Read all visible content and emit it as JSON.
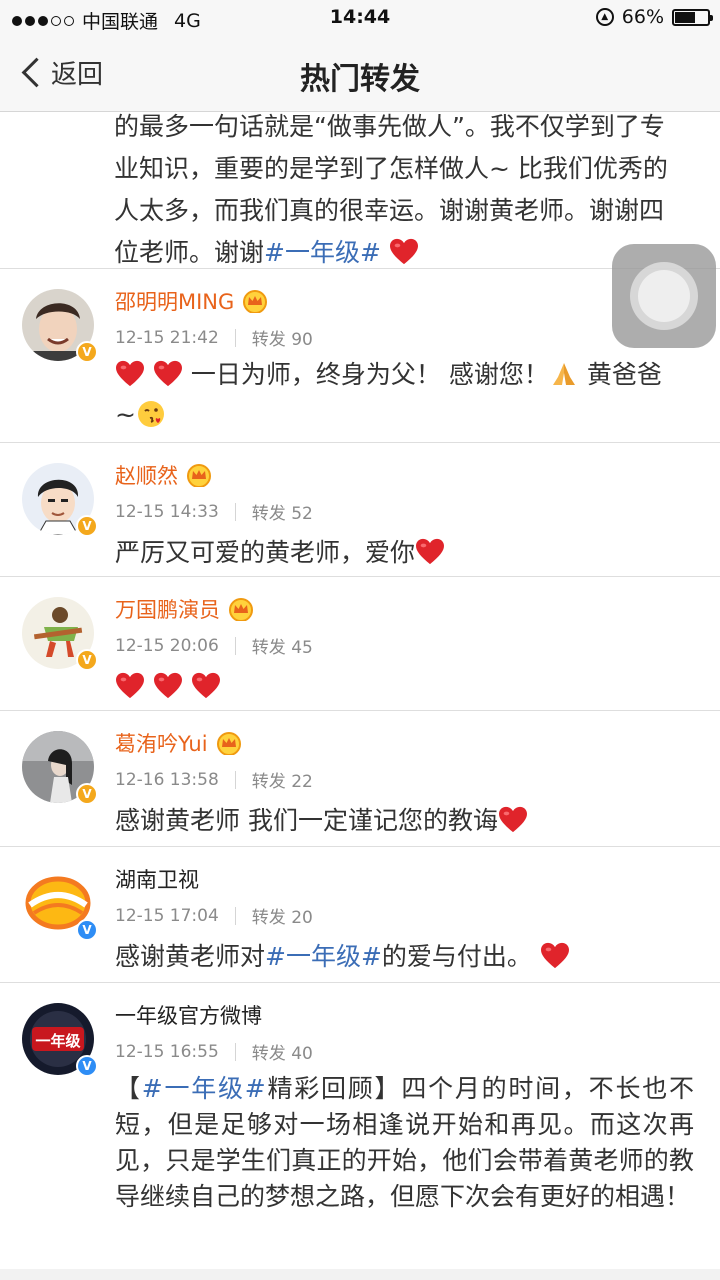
{
  "status_bar": {
    "carrier": "中国联通",
    "network": "4G",
    "time": "14:44",
    "battery_text": "66%",
    "battery_level": 0.66
  },
  "nav": {
    "back_label": "返回",
    "title": "热门转发"
  },
  "top_card": {
    "lines": [
      "的最多一句话就是“做事先做人”。我不仅学到了专",
      "业知识，重要的是学到了怎样做人~ 比我们优秀的",
      "人太多，而我们真的很幸运。谢谢黄老师。谢谢四",
      "位老师。谢谢"
    ],
    "hashtag": "#一年级#"
  },
  "posts": [
    {
      "name": "邵明明MING",
      "time": "12-15 21:42",
      "repost_label": "转发 90",
      "text_a": "一日为师，终身为父！ 感谢您！",
      "text_b": "黄爸爸",
      "text_c": "~",
      "verified": "gold"
    },
    {
      "name": "赵顺然",
      "time": "12-15 14:33",
      "repost_label": "转发 52",
      "text": "严厉又可爱的黄老师，爱你",
      "verified": "gold"
    },
    {
      "name": "万国鹏演员",
      "time": "12-15 20:06",
      "repost_label": "转发 45",
      "verified": "gold"
    },
    {
      "name": "葛洧吟Yui",
      "time": "12-16 13:58",
      "repost_label": "转发 22",
      "text": "感谢黄老师 我们一定谨记您的教诲",
      "verified": "gold"
    },
    {
      "name": "湖南卫视",
      "time": "12-15 17:04",
      "repost_label": "转发 20",
      "text_pre": "感谢黄老师对",
      "hashtag": "#一年级#",
      "text_post": "的爱与付出。",
      "verified": "blue"
    },
    {
      "name": "一年级官方微博",
      "time": "12-15 16:55",
      "repost_label": "转发 40",
      "text_open": "【",
      "hashtag": "#一年级#",
      "text_rest": "精彩回顾】四个月的时间，不长也不短，但是足够对一场相逢说开始和再见。而这次再见，只是学生们真正的开始，他们会带着黄老师的教导继续自己的梦想之路，但愿下次会有更好的相遇！",
      "verified": "blue",
      "avatar_text": "一年级"
    }
  ],
  "icons": {
    "back": "chevron-left-icon",
    "crown": "crown-icon",
    "heart": "heart-icon",
    "pray": "pray-emoji-icon",
    "kiss": "kiss-emoji-icon",
    "assistive_touch": "assistive-touch-icon"
  },
  "colors": {
    "vip_name": "#e8631b",
    "hashtag": "#3b6db6",
    "heart": "#e0242b",
    "verified_gold": "#f4a81c",
    "verified_blue": "#2e8df5"
  }
}
